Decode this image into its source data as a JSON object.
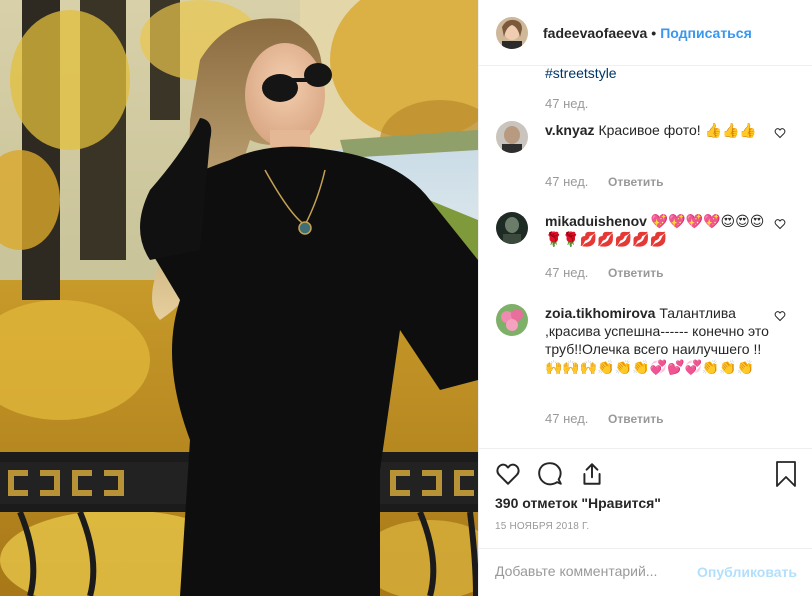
{
  "header": {
    "username": "fadeevaofaeeva",
    "separator": "•",
    "follow_label": "Подписаться"
  },
  "caption": {
    "hashtag": "#streetstyle",
    "time": "47 нед."
  },
  "comments": [
    {
      "username": "v.knyaz",
      "text": "Красивое фото! 👍👍👍",
      "time": "47 нед.",
      "reply_label": "Ответить"
    },
    {
      "username": "mikaduishenov",
      "text": "💖💖💖💖😍😍😍🌹🌹💋💋💋💋💋",
      "time": "47 нед.",
      "reply_label": "Ответить"
    },
    {
      "username": "zoia.tikhomirova",
      "text": "Талантлива ,красива успешна------ конечно это труб!!Олечка всего наилучшего !!🙌🙌🙌👏👏👏💞💕💞👏👏👏",
      "time": "47 нед.",
      "reply_label": "Ответить"
    }
  ],
  "footer": {
    "likes": "390 отметок \"Нравится\"",
    "date": "15 НОЯБРЯ 2018 Г.",
    "comment_placeholder": "Добавьте комментарий...",
    "publish_label": "Опубликовать"
  },
  "icons": {
    "like": "heart-icon",
    "comment": "comment-icon",
    "share": "share-icon",
    "save": "bookmark-icon",
    "comment_like": "heart-icon"
  },
  "colors": {
    "link_blue": "#3897f0",
    "hashtag": "#003569",
    "muted": "#999999",
    "publish_disabled": "#b2dffc",
    "divider": "#efefef"
  }
}
